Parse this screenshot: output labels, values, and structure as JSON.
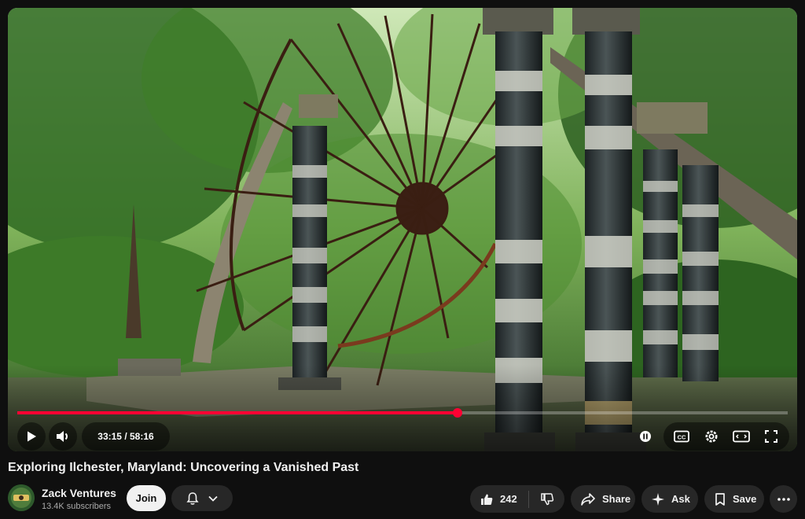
{
  "player": {
    "current_time": "33:15",
    "duration": "58:16",
    "progress": 0.571,
    "accent_color": "#ff0033"
  },
  "video": {
    "title": "Exploring Ilchester, Maryland: Uncovering a Vanished Past"
  },
  "channel": {
    "name": "Zack Ventures",
    "subscribers": "13.4K subscribers",
    "join_label": "Join"
  },
  "actions": {
    "like_count": "242",
    "share_label": "Share",
    "ask_label": "Ask",
    "save_label": "Save"
  },
  "icons": [
    "play-icon",
    "volume-icon",
    "pause-icon",
    "captions-icon",
    "settings-icon",
    "theater-icon",
    "fullscreen-icon",
    "bell-icon",
    "chevron-down-icon",
    "like-icon",
    "dislike-icon",
    "share-icon",
    "ask-icon",
    "save-icon",
    "more-icon"
  ]
}
